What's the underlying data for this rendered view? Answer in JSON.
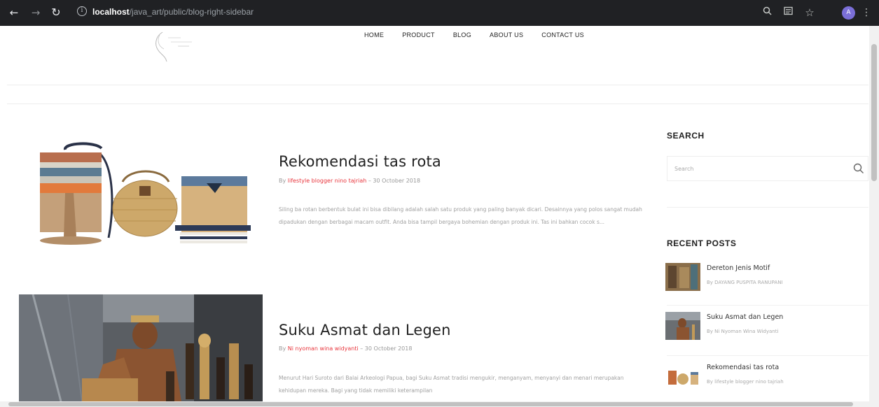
{
  "browser": {
    "url_host": "localhost",
    "url_path": "/java_art/public/blog-right-sidebar",
    "profile_initial": "A"
  },
  "nav": {
    "items": [
      {
        "label": "HOME"
      },
      {
        "label": "PRODUCT"
      },
      {
        "label": "BLOG"
      },
      {
        "label": "ABOUT US"
      },
      {
        "label": "CONTACT US"
      }
    ]
  },
  "posts": [
    {
      "title": "Rekomendasi tas rota",
      "by": "By ",
      "author": "lifestyle blogger nino tajriah",
      "date": " –  30 October 2018",
      "excerpt": "Siling ba rotan berbentuk bulat ini bisa dibilang adalah salah satu produk yang paling banyak dicari. Desainnya yang polos sangat mudah dipadukan dengan berbagai macam outfit. Anda bisa tampil bergaya bohemian dengan produk ini. Tas ini bahkan cocok s..."
    },
    {
      "title": "Suku Asmat dan Legen",
      "by": "By ",
      "author": "Ni nyoman wina widyanti",
      "date": " –  30 October 2018",
      "excerpt": "Menurut Hari Suroto dari Balai Arkeologi Papua, bagi Suku Asmat tradisi mengukir, menganyam, menyanyi dan menari merupakan kehidupan mereka. Bagi yang tidak memiliki keterampilan"
    }
  ],
  "sidebar": {
    "search_heading": "SEARCH",
    "search_placeholder": "Search",
    "recent_heading": "RECENT POSTS",
    "recent": [
      {
        "title": "Dereton Jenis Motif",
        "by": "By DAYANG PUSPITA RANUPANI"
      },
      {
        "title": "Suku Asmat dan Legen",
        "by": "By Ni Nyoman Wina Widyanti"
      },
      {
        "title": "Rekomendasi tas rota",
        "by": "By lifestyle blogger nino tajriah"
      }
    ]
  }
}
